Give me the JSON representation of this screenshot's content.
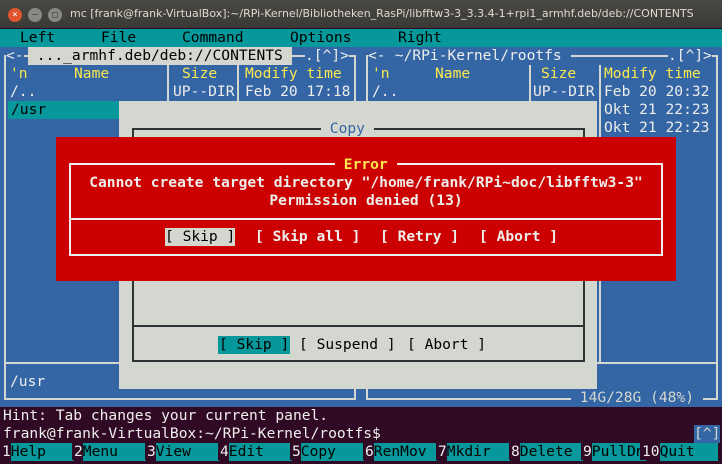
{
  "window": {
    "title": "mc [frank@frank-VirtualBox]:~/RPi-Kernel/Bibliotheken_RasPi/libfftw3-3_3.3.4-1+rpi1_armhf.deb/deb://CONTENTS"
  },
  "menu": [
    "Left",
    "File",
    "Command",
    "Options",
    "Right"
  ],
  "left_panel": {
    "path": " ..._armhf.deb/deb://CONTENTS ",
    "indicator": ".[^]>",
    "cols": [
      "'n",
      "Name",
      "Size",
      "Modify time"
    ],
    "rows": [
      {
        "name": "/..",
        "size": "UP--DIR",
        "time": "Feb 20 17:18"
      },
      {
        "name": "/usr",
        "size": "",
        "time": ""
      }
    ],
    "status": "/usr"
  },
  "right_panel": {
    "path": " ~/RPi-Kernel/rootfs ",
    "indicator": ".[^]>",
    "cols": [
      "'n",
      "Name",
      "Size",
      "Modify time"
    ],
    "rows": [
      {
        "name": "/..",
        "size": "UP--DIR",
        "time": "Feb 20 20:32"
      },
      {
        "time": "Okt 21 22:23"
      },
      {
        "time": "Okt 21 22:23"
      }
    ],
    "disk": " 14G/28G (48%) "
  },
  "copy_dialog": {
    "title": " Copy ",
    "buttons": [
      "[ Skip ]",
      "[ Suspend ]",
      "[ Abort ]"
    ]
  },
  "error_dialog": {
    "title": " Error ",
    "message": "Cannot create target directory \"/home/frank/RPi~doc/libfftw3-3\"",
    "detail": "Permission denied (13)",
    "buttons": [
      "[ Skip ]",
      "[ Skip all ]",
      "[ Retry ]",
      "[ Abort ]"
    ]
  },
  "hint": "Hint: Tab changes your current panel.",
  "prompt": "frank@frank-VirtualBox:~/RPi-Kernel/rootfs$",
  "prompt_indicator": "[^]",
  "fkeys": [
    {
      "n": "1",
      "l": "Help"
    },
    {
      "n": "2",
      "l": "Menu"
    },
    {
      "n": "3",
      "l": "View"
    },
    {
      "n": "4",
      "l": "Edit"
    },
    {
      "n": "5",
      "l": "Copy"
    },
    {
      "n": "6",
      "l": "RenMov"
    },
    {
      "n": "7",
      "l": "Mkdir"
    },
    {
      "n": "8",
      "l": "Delete"
    },
    {
      "n": "9",
      "l": "PullDn"
    },
    {
      "n": "10",
      "l": "Quit"
    }
  ],
  "colors": {
    "panel": "#3465a4",
    "menu": "#06989a",
    "error": "#cc0000",
    "dialog": "#d3d7cf",
    "terminal": "#300a24"
  }
}
